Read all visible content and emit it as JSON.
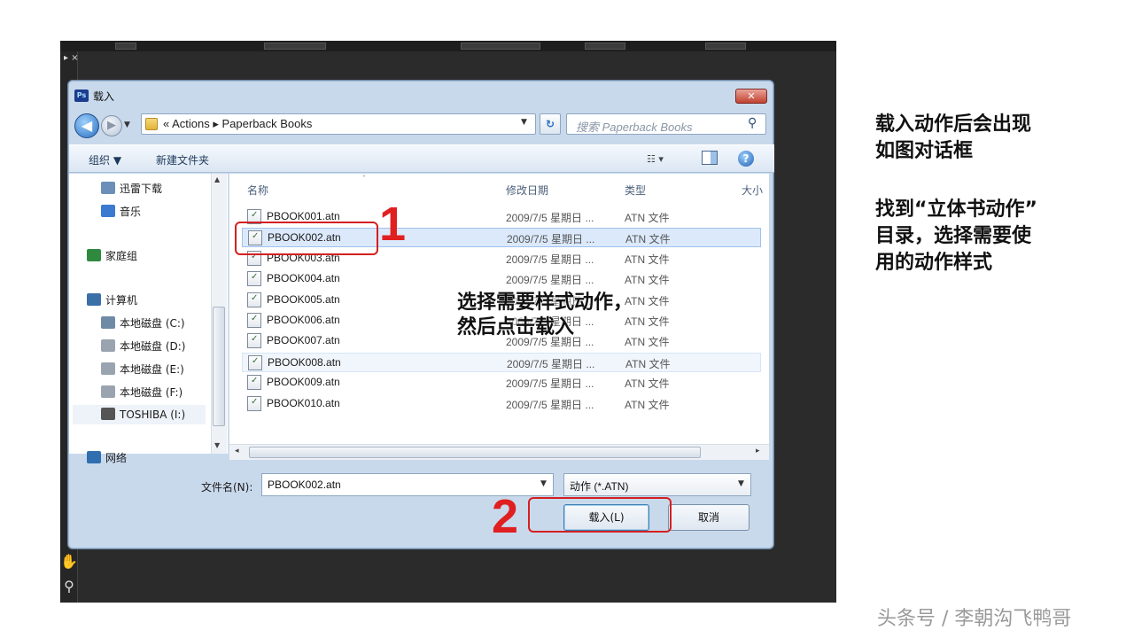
{
  "dialog": {
    "title": "载入",
    "ps_logo": "Ps",
    "close_glyph": "✕",
    "nav": {
      "back": "◀",
      "forward": "▶",
      "drop": "▼"
    },
    "address": {
      "prefix": "«",
      "parts": [
        "Actions",
        "Paperback Books"
      ],
      "separator": "▸",
      "text": "« Actions ▸ Paperback Books"
    },
    "refresh_glyph": "↻",
    "search": {
      "placeholder": "搜索 Paperback Books",
      "icon": "search-icon"
    },
    "toolbar": {
      "organize": "组织 ▼",
      "new_folder": "新建文件夹",
      "view_glyph": "☷ ▾",
      "help_glyph": "?"
    },
    "sidebar": {
      "items": [
        {
          "label": "迅雷下载",
          "icon": "download-folder-icon",
          "color": "#6b8fb8"
        },
        {
          "label": "音乐",
          "icon": "music-icon",
          "color": "#3a7ad0"
        },
        {
          "label": "家庭组",
          "icon": "homegroup-icon",
          "color": "#2f8a3f"
        },
        {
          "label": "计算机",
          "icon": "computer-icon",
          "color": "#3b6fa8"
        },
        {
          "label": "本地磁盘 (C:)",
          "icon": "system-drive-icon",
          "color": "#6f8aa6"
        },
        {
          "label": "本地磁盘 (D:)",
          "icon": "drive-icon",
          "color": "#9aa4b0"
        },
        {
          "label": "本地磁盘 (E:)",
          "icon": "drive-icon",
          "color": "#9aa4b0"
        },
        {
          "label": "本地磁盘 (F:)",
          "icon": "drive-icon",
          "color": "#9aa4b0"
        },
        {
          "label": "TOSHIBA (I:)",
          "icon": "usb-drive-icon",
          "color": "#555555"
        },
        {
          "label": "网络",
          "icon": "network-icon",
          "color": "#2f6fb0"
        }
      ]
    },
    "columns": {
      "name": "名称",
      "modified": "修改日期",
      "type": "类型",
      "size": "大小"
    },
    "files": [
      {
        "name": "PBOOK001.atn",
        "date": "2009/7/5 星期日 ...",
        "type": "ATN 文件"
      },
      {
        "name": "PBOOK002.atn",
        "date": "2009/7/5 星期日 ...",
        "type": "ATN 文件"
      },
      {
        "name": "PBOOK003.atn",
        "date": "2009/7/5 星期日 ...",
        "type": "ATN 文件"
      },
      {
        "name": "PBOOK004.atn",
        "date": "2009/7/5 星期日 ...",
        "type": "ATN 文件"
      },
      {
        "name": "PBOOK005.atn",
        "date": "2009/7/5 星期日 ...",
        "type": "ATN 文件"
      },
      {
        "name": "PBOOK006.atn",
        "date": "2009/7/5 星期日 ...",
        "type": "ATN 文件"
      },
      {
        "name": "PBOOK007.atn",
        "date": "2009/7/5 星期日 ...",
        "type": "ATN 文件"
      },
      {
        "name": "PBOOK008.atn",
        "date": "2009/7/5 星期日 ...",
        "type": "ATN 文件"
      },
      {
        "name": "PBOOK009.atn",
        "date": "2009/7/5 星期日 ...",
        "type": "ATN 文件"
      },
      {
        "name": "PBOOK010.atn",
        "date": "2009/7/5 星期日 ...",
        "type": "ATN 文件"
      }
    ],
    "selected_index": 1,
    "hovered_index": 7,
    "filename": {
      "label": "文件名(N):",
      "value": "PBOOK002.atn",
      "drop": "▼"
    },
    "filetype": {
      "value": "动作 (*.ATN)",
      "drop": "▼"
    },
    "buttons": {
      "load": "载入(L)",
      "cancel": "取消"
    }
  },
  "annotations": {
    "step1": "1",
    "step2": "2",
    "callout_line1": "选择需要样式动作，",
    "callout_line2": "然后点击载入",
    "accent_color": "#e02020"
  },
  "side_text": {
    "p1_line1": "载入动作后会出现",
    "p1_line2": "如图对话框",
    "p2_line1": "找到“立体书动作”",
    "p2_line2": "目录，选择需要使",
    "p2_line3": "用的动作样式"
  },
  "watermark": "头条号 / 李朝沟飞鸭哥",
  "photoshop": {
    "panel_close": "▸ ×"
  }
}
